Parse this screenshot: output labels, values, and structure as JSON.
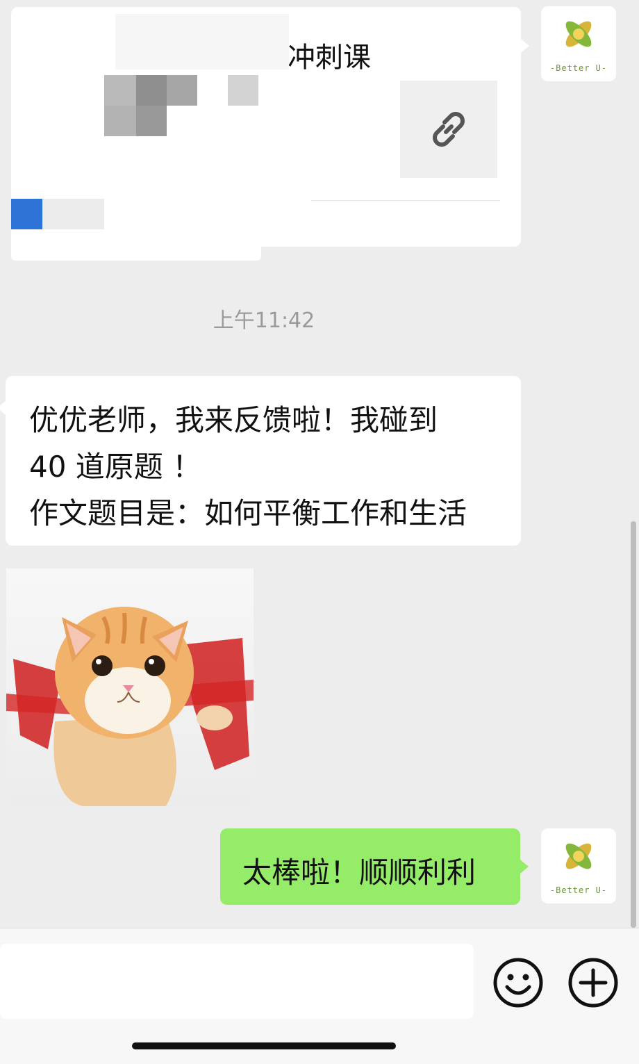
{
  "link_card": {
    "title": "冲刺课"
  },
  "timestamp": "上午11:42",
  "received_message": {
    "lines": [
      "优优老师，我来反馈啦！我碰到",
      "40 道原题 ！",
      "作文题目是：如何平衡工作和生活"
    ]
  },
  "sticker": {
    "description_icon": "cat-sticker-icon"
  },
  "sent_message": {
    "text": "太棒啦！顺顺利利"
  },
  "avatar": {
    "brand_text": "-Better U-"
  },
  "input_bar": {
    "emoji_icon": "emoji-icon",
    "plus_icon": "plus-icon"
  },
  "colors": {
    "background": "#ededed",
    "sent_bubble": "#95ec69",
    "received_bubble": "#ffffff",
    "link_blue": "#2e74d6"
  }
}
